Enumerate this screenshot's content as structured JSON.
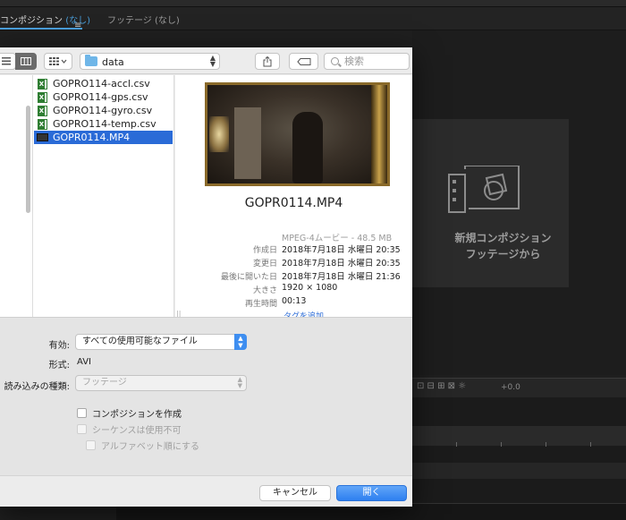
{
  "app": {
    "tabs": [
      {
        "label": "コンポジション",
        "suffix": "(なし)"
      },
      {
        "label": "フッテージ (なし)"
      }
    ],
    "menu_icon": "hamburger-icon",
    "new_comp_line1": "新規コンポジション",
    "new_comp_line2": "フッテージから",
    "timeline_value": "+0.0"
  },
  "dialog": {
    "location": "data",
    "search_placeholder": "検索",
    "files": [
      {
        "name": "GOPRO114-accl.csv",
        "icon": "excel-file-icon",
        "selected": false
      },
      {
        "name": "GOPRO114-gps.csv",
        "icon": "excel-file-icon",
        "selected": false
      },
      {
        "name": "GOPRO114-gyro.csv",
        "icon": "excel-file-icon",
        "selected": false
      },
      {
        "name": "GOPRO114-temp.csv",
        "icon": "excel-file-icon",
        "selected": false
      },
      {
        "name": "GOPR0114.MP4",
        "icon": "video-file-icon",
        "selected": true
      }
    ],
    "preview": {
      "title": "GOPR0114.MP4",
      "kind": "MPEG-4ムービー - 48.5 MB",
      "fields": [
        {
          "label": "作成日",
          "value": "2018年7月18日 水曜日 20:35"
        },
        {
          "label": "変更日",
          "value": "2018年7月18日 水曜日 20:35"
        },
        {
          "label": "最後に開いた日",
          "value": "2018年7月18日 水曜日 21:36"
        },
        {
          "label": "大きさ",
          "value": "1920 × 1080"
        },
        {
          "label": "再生時間",
          "value": "00:13"
        }
      ],
      "add_tags": "タグを追加..."
    },
    "options": {
      "enable_label": "有効:",
      "enable_value": "すべての使用可能なファイル",
      "format_label": "形式:",
      "format_value": "AVI",
      "import_as_label": "読み込みの種類:",
      "import_as_value": "フッテージ",
      "create_comp": "コンポジションを作成",
      "sequence": "シーケンスは使用不可",
      "alphabetical": "アルファベット順にする"
    },
    "buttons": {
      "cancel": "キャンセル",
      "open": "開く"
    }
  }
}
